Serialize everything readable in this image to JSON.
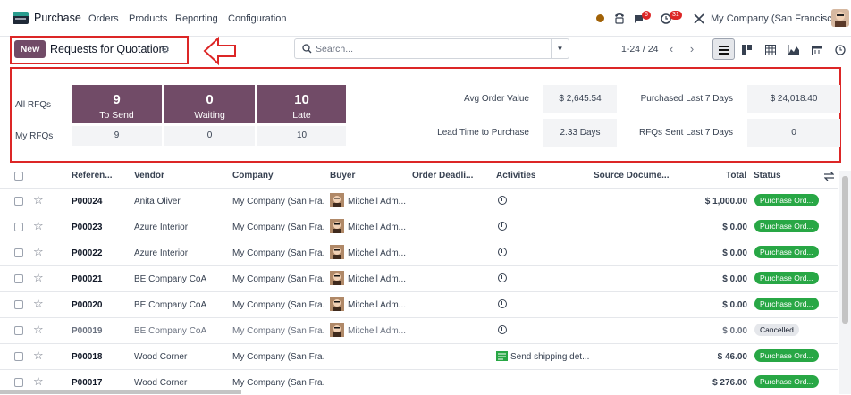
{
  "nav": {
    "app_name": "Purchase",
    "menu": [
      "Orders",
      "Products",
      "Reporting",
      "Configuration"
    ],
    "call_badge": "",
    "chat_badge": "6",
    "activity_badge": "31",
    "company": "My Company (San Francisco)"
  },
  "control": {
    "new_label": "New",
    "title": "Requests for Quotation",
    "search_placeholder": "Search...",
    "pager": "1-24 / 24"
  },
  "dashboard": {
    "row1_label": "All RFQs",
    "row2_label": "My RFQs",
    "tiles": [
      {
        "value": "9",
        "label": "To Send",
        "my": "9"
      },
      {
        "value": "0",
        "label": "Waiting",
        "my": "0"
      },
      {
        "value": "10",
        "label": "Late",
        "my": "10"
      }
    ],
    "kpis": [
      {
        "label": "Avg Order Value",
        "value": "$ 2,645.54"
      },
      {
        "label": "Purchased Last 7 Days",
        "value": "$ 24,018.40"
      },
      {
        "label": "Lead Time to Purchase",
        "value": "2.33 Days"
      },
      {
        "label": "RFQs Sent Last 7 Days",
        "value": "0"
      }
    ]
  },
  "table": {
    "headers": [
      "Referen...",
      "Vendor",
      "Company",
      "Buyer",
      "Order Deadli...",
      "Activities",
      "Source Docume...",
      "Total",
      "Status"
    ],
    "rows": [
      {
        "ref": "P00024",
        "vendor": "Anita Oliver",
        "company": "My Company (San Fra...",
        "buyer": "Mitchell Adm...",
        "activity": "",
        "total": "$ 1,000.00",
        "status": "Purchase Ord...",
        "muted": false
      },
      {
        "ref": "P00023",
        "vendor": "Azure Interior",
        "company": "My Company (San Fra...",
        "buyer": "Mitchell Adm...",
        "activity": "",
        "total": "$ 0.00",
        "status": "Purchase Ord...",
        "muted": false
      },
      {
        "ref": "P00022",
        "vendor": "Azure Interior",
        "company": "My Company (San Fra...",
        "buyer": "Mitchell Adm...",
        "activity": "",
        "total": "$ 0.00",
        "status": "Purchase Ord...",
        "muted": false
      },
      {
        "ref": "P00021",
        "vendor": "BE Company CoA",
        "company": "My Company (San Fra...",
        "buyer": "Mitchell Adm...",
        "activity": "",
        "total": "$ 0.00",
        "status": "Purchase Ord...",
        "muted": false
      },
      {
        "ref": "P00020",
        "vendor": "BE Company CoA",
        "company": "My Company (San Fra...",
        "buyer": "Mitchell Adm...",
        "activity": "",
        "total": "$ 0.00",
        "status": "Purchase Ord...",
        "muted": false
      },
      {
        "ref": "P00019",
        "vendor": "BE Company CoA",
        "company": "My Company (San Fra...",
        "buyer": "Mitchell Adm...",
        "activity": "",
        "total": "$ 0.00",
        "status": "Cancelled",
        "muted": true
      },
      {
        "ref": "P00018",
        "vendor": "Wood Corner",
        "company": "My Company (San Fra...",
        "buyer": "",
        "activity": "Send shipping det...",
        "total": "$ 46.00",
        "status": "Purchase Ord...",
        "muted": false
      },
      {
        "ref": "P00017",
        "vendor": "Wood Corner",
        "company": "My Company (San Fra...",
        "buyer": "",
        "activity": "",
        "total": "$ 276.00",
        "status": "Purchase Ord...",
        "muted": false
      }
    ]
  }
}
